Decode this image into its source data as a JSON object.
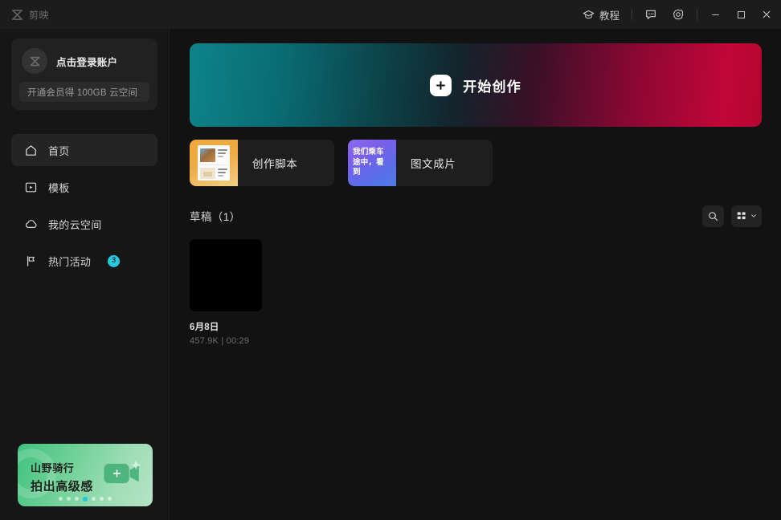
{
  "titlebar": {
    "logo_text": "剪映",
    "logo_icon": "jianying-logo-icon",
    "tutorial_label": "教程",
    "tutorial_icon": "graduation-cap-icon",
    "feedback_icon": "chat-bubble-icon",
    "settings_icon": "gear-icon",
    "minimize_icon": "minimize-icon",
    "maximize_icon": "maximize-icon",
    "close_icon": "close-icon"
  },
  "sidebar": {
    "account": {
      "name": "点击登录账户",
      "avatar_icon": "jianying-logo-icon",
      "vip_text": "开通会员得 100GB 云空间"
    },
    "nav": [
      {
        "label": "首页",
        "icon": "home-icon",
        "active": true,
        "badge": ""
      },
      {
        "label": "模板",
        "icon": "template-icon",
        "active": false,
        "badge": ""
      },
      {
        "label": "我的云空间",
        "icon": "cloud-icon",
        "active": false,
        "badge": ""
      },
      {
        "label": "热门活动",
        "icon": "flag-icon",
        "active": false,
        "badge": "3"
      }
    ],
    "promo": {
      "line1": "山野骑行",
      "line2": "拍出高级感",
      "icon": "camera-icon",
      "dots_total": 7,
      "dot_active_index": 3
    }
  },
  "main": {
    "hero": {
      "label": "开始创作",
      "icon": "plus-icon",
      "gradient_start": "#0d8489",
      "gradient_end": "#c00738"
    },
    "quick_cards": [
      {
        "label": "创作脚本",
        "thumb_kind": "script",
        "thumb_text": "",
        "accent": "#f0a83a"
      },
      {
        "label": "图文成片",
        "thumb_kind": "imgtext",
        "thumb_text": "我们乘车途中，看到",
        "accent": "#7b5eea"
      }
    ],
    "section": {
      "title": "草稿（1）",
      "search_icon": "search-icon",
      "view_icon": "grid-view-icon",
      "view_chevron_icon": "chevron-down-icon"
    },
    "drafts": [
      {
        "title": "6月8日",
        "meta": "457.9K | 00:29"
      }
    ]
  },
  "colors": {
    "badge": "#26c8dc",
    "app_bg": "#121212",
    "sidebar_bg": "#161616",
    "titlebar_bg": "#1c1c1c"
  }
}
